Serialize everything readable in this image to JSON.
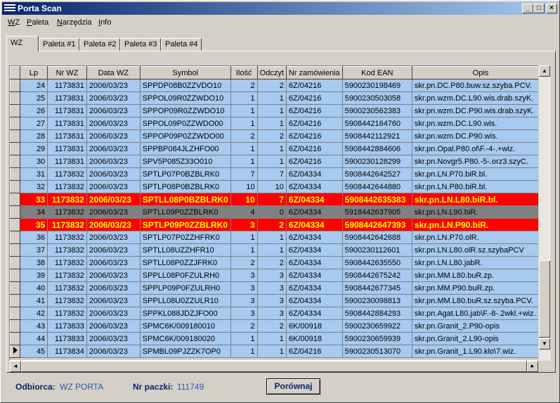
{
  "window": {
    "title": "Porta Scan"
  },
  "menu": [
    "WZ",
    "Paleta",
    "Narzędzia",
    "Info"
  ],
  "tabs": [
    "WZ",
    "Paleta #1",
    "Paleta #2",
    "Paleta #3",
    "Paleta #4"
  ],
  "active_tab": "WZ",
  "table": {
    "columns": [
      "Lp",
      "Nr WZ",
      "Data WZ",
      "Symbol",
      "Ilość",
      "Odczyt",
      "Nr zamówienia",
      "Kod EAN",
      "Opis"
    ],
    "rows": [
      {
        "lp": "24",
        "nrwz": "1173831",
        "data": "2006/03/23",
        "symbol": "SPPDP08B0ZZVDO10",
        "ilosc": "2",
        "odczyt": "2",
        "zam": "6Z/04216",
        "ean": "5900230198469",
        "opis": "skr.pn.DC.P80.buw.sz.szyba.PCV.",
        "state": "normal"
      },
      {
        "lp": "25",
        "nrwz": "1173831",
        "data": "2006/03/23",
        "symbol": "SPPOL09R0ZZWDO10",
        "ilosc": "1",
        "odczyt": "1",
        "zam": "6Z/04216",
        "ean": "5900230503058",
        "opis": "skr.pn.wzm.DC.L90.wis.drab.szyK.",
        "state": "normal"
      },
      {
        "lp": "26",
        "nrwz": "1173831",
        "data": "2006/03/23",
        "symbol": "SPPOP09R0ZZWDO10",
        "ilosc": "1",
        "odczyt": "1",
        "zam": "6Z/04216",
        "ean": "5900230562383",
        "opis": "skr.pn.wzm.DC.P90.wis.drab.szyK.",
        "state": "normal"
      },
      {
        "lp": "27",
        "nrwz": "1173831",
        "data": "2006/03/23",
        "symbol": "SPPOL09P0ZZWDO00",
        "ilosc": "1",
        "odczyt": "1",
        "zam": "6Z/04216",
        "ean": "5908442164760",
        "opis": "skr.pn.wzm.DC.L90.wis.",
        "state": "normal"
      },
      {
        "lp": "28",
        "nrwz": "1173831",
        "data": "2006/03/23",
        "symbol": "SPPOP09P0ZZWDO00",
        "ilosc": "2",
        "odczyt": "2",
        "zam": "6Z/04216",
        "ean": "5908442112921",
        "opis": "skr.pn.wzm.DC.P90.wis.",
        "state": "normal"
      },
      {
        "lp": "29",
        "nrwz": "1173831",
        "data": "2006/03/23",
        "symbol": "SPPBP084JLZHFO00",
        "ilosc": "1",
        "odczyt": "1",
        "zam": "6Z/04216",
        "ean": "5908442884606",
        "opis": "skr.pn.Opal.P80.ol\\F.-4-.+wiz.",
        "state": "normal"
      },
      {
        "lp": "30",
        "nrwz": "1173831",
        "data": "2006/03/23",
        "symbol": "SPV5P085Z33O010",
        "ilosc": "1",
        "odczyt": "1",
        "zam": "6Z/04216",
        "ean": "5900230128299",
        "opis": "skr.pn.Novgr5.P80.-5-.orz3.szyC.",
        "state": "normal"
      },
      {
        "lp": "31",
        "nrwz": "1173832",
        "data": "2006/03/23",
        "symbol": "SPTLP07P0BZBLRK0",
        "ilosc": "7",
        "odczyt": "7",
        "zam": "6Z/04334",
        "ean": "5908442642527",
        "opis": "skr.pn.LN.P70.biR.bl.",
        "state": "normal"
      },
      {
        "lp": "32",
        "nrwz": "1173832",
        "data": "2006/03/23",
        "symbol": "SPTLP08P0BZBLRK0",
        "ilosc": "10",
        "odczyt": "10",
        "zam": "6Z/04334",
        "ean": "5908442644880",
        "opis": "skr.pn.LN.P80.biR.bl.",
        "state": "normal"
      },
      {
        "lp": "33",
        "nrwz": "1173832",
        "data": "2006/03/23",
        "symbol": "SPTLL08P0BZBLRK0",
        "ilosc": "10",
        "odczyt": "7",
        "zam": "6Z/04334",
        "ean": "5908442635383",
        "opis": "skr.pn.LN.L80.biR.bl.",
        "state": "red"
      },
      {
        "lp": "34",
        "nrwz": "1173832",
        "data": "2006/03/23",
        "symbol": "SPTLL09P0ZZBLRK0",
        "ilosc": "4",
        "odczyt": "0",
        "zam": "6Z/04334",
        "ean": "5918442637905",
        "opis": "skr.pn.LN.L90.biR.",
        "state": "gray"
      },
      {
        "lp": "35",
        "nrwz": "1173832",
        "data": "2006/03/23",
        "symbol": "SPTLP09P0ZZBLRK0",
        "ilosc": "3",
        "odczyt": "2",
        "zam": "6Z/04334",
        "ean": "5908442647393",
        "opis": "skr.pn.LN.P90.biR.",
        "state": "red"
      },
      {
        "lp": "36",
        "nrwz": "1173832",
        "data": "2006/03/23",
        "symbol": "SPTLP07P0ZZHFRK0",
        "ilosc": "1",
        "odczyt": "1",
        "zam": "6Z/04334",
        "ean": "5908442642688",
        "opis": "skr.pn.LN.P70.olR.",
        "state": "normal"
      },
      {
        "lp": "37",
        "nrwz": "1173832",
        "data": "2006/03/23",
        "symbol": "SPTLL08UZZHFR10",
        "ilosc": "1",
        "odczyt": "1",
        "zam": "6Z/04334",
        "ean": "5900230112601",
        "opis": "skr.pn.LN.L80.olR.sz.szybaPCV",
        "state": "normal"
      },
      {
        "lp": "38",
        "nrwz": "1173832",
        "data": "2006/03/23",
        "symbol": "SPTLL08P0ZZJFRK0",
        "ilosc": "2",
        "odczyt": "2",
        "zam": "6Z/04334",
        "ean": "5908442635550",
        "opis": "skr.pn.LN.L80.jabR.",
        "state": "normal"
      },
      {
        "lp": "39",
        "nrwz": "1173832",
        "data": "2006/03/23",
        "symbol": "SPPLL08P0FZULRH0",
        "ilosc": "3",
        "odczyt": "3",
        "zam": "6Z/04334",
        "ean": "5908442675242",
        "opis": "skr.pn.MM.L80.buR.zp.",
        "state": "normal"
      },
      {
        "lp": "40",
        "nrwz": "1173832",
        "data": "2006/03/23",
        "symbol": "SPPLP09P0FZULRH0",
        "ilosc": "3",
        "odczyt": "3",
        "zam": "6Z/04334",
        "ean": "5908442677345",
        "opis": "skr.pn.MM.P90.buR.zp.",
        "state": "normal"
      },
      {
        "lp": "41",
        "nrwz": "1173832",
        "data": "2006/03/23",
        "symbol": "SPPLL08U0ZZULR10",
        "ilosc": "3",
        "odczyt": "3",
        "zam": "6Z/04334",
        "ean": "5900230098813",
        "opis": "skr.pn.MM.L80.buR.sz.szyba.PCV.",
        "state": "normal"
      },
      {
        "lp": "42",
        "nrwz": "1173832",
        "data": "2006/03/23",
        "symbol": "SPPKL088JDZJFO00",
        "ilosc": "3",
        "odczyt": "3",
        "zam": "6Z/04334",
        "ean": "5908442884293",
        "opis": "skr.pn.Agat.L80.jab\\F.-8-.2wkl.+wiz.",
        "state": "normal"
      },
      {
        "lp": "43",
        "nrwz": "1173833",
        "data": "2006/03/23",
        "symbol": "SPMC6K/009180010",
        "ilosc": "2",
        "odczyt": "2",
        "zam": "6K/00918",
        "ean": "5900230659922",
        "opis": "skr.pn.Granit_2.P90-opis",
        "state": "normal"
      },
      {
        "lp": "44",
        "nrwz": "1173833",
        "data": "2006/03/23",
        "symbol": "SPMC6K/009180020",
        "ilosc": "1",
        "odczyt": "1",
        "zam": "6K/00918",
        "ean": "5900230659939",
        "opis": "skr.pn.Granit_2.L90-opis",
        "state": "normal"
      },
      {
        "lp": "45",
        "nrwz": "1173834",
        "data": "2006/03/23",
        "symbol": "SPMBL09PJZZK7OP0",
        "ilosc": "1",
        "odczyt": "1",
        "zam": "6Z/04216",
        "ean": "5900230513070",
        "opis": "skr.pn.Granit_1.L90.klo\\7.wiz.",
        "state": "normal",
        "current": true
      }
    ]
  },
  "footer": {
    "odbiorca_label": "Odbiorca:",
    "odbiorca_value": "WZ PORTA",
    "paczki_label": "Nr paczki:",
    "paczki_value": "111749",
    "compare_button": "Porównaj"
  }
}
